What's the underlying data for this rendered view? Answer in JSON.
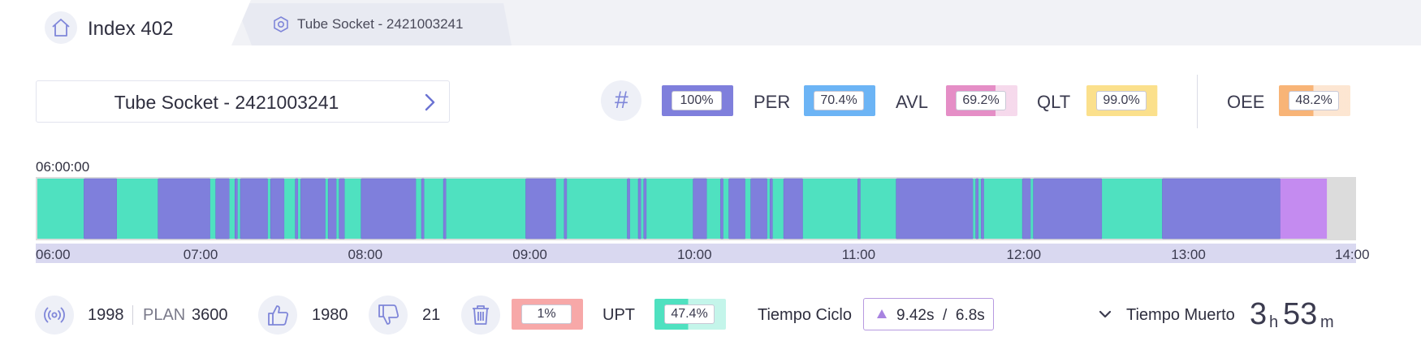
{
  "tabs": {
    "home_icon": "home-icon",
    "active_title": "Index 402",
    "second_icon": "hexagon-icon",
    "second_label": "Tube Socket - 2421003241"
  },
  "selector": {
    "label": "Tube Socket - 2421003241",
    "icon": "chevron-right-icon"
  },
  "metrics": {
    "hash_label": "#",
    "items": [
      {
        "label": "",
        "value": "100%",
        "color": "#7f7fdc",
        "fill": 1.0
      },
      {
        "label": "PER",
        "value": "70.4%",
        "color": "#6cb4f5",
        "fill": 1.0
      },
      {
        "label": "AVL",
        "value": "69.2%",
        "color": "#e58ec6",
        "fill": 0.692
      },
      {
        "label": "QLT",
        "value": "99.0%",
        "color": "#fbe08c",
        "fill": 0.99
      },
      {
        "label": "OEE",
        "value": "48.2%",
        "color": "#f8b477",
        "fill": 0.482
      }
    ]
  },
  "timeline": {
    "start_time": "06:00:00",
    "axis_labels": [
      "06:00",
      "07:00",
      "08:00",
      "09:00",
      "10:00",
      "11:00",
      "12:00",
      "13:00",
      "14:00"
    ],
    "colors": {
      "running": "#4fe1c0",
      "stopped": "#7f7fdc",
      "setup": "#c48bf0",
      "empty": "#dcdcdc",
      "background": "#d9d8f0"
    },
    "segments": [
      [
        "06:00",
        "06:17",
        "running"
      ],
      [
        "06:17",
        "06:29",
        "stopped"
      ],
      [
        "06:29",
        "06:44",
        "running"
      ],
      [
        "06:44",
        "07:03",
        "stopped"
      ],
      [
        "07:03",
        "07:05",
        "running"
      ],
      [
        "07:05",
        "07:10",
        "stopped"
      ],
      [
        "07:10",
        "07:12",
        "running"
      ],
      [
        "07:12",
        "07:13",
        "stopped"
      ],
      [
        "07:13",
        "07:14",
        "running"
      ],
      [
        "07:14",
        "07:24",
        "stopped"
      ],
      [
        "07:24",
        "07:25",
        "running"
      ],
      [
        "07:25",
        "07:30",
        "stopped"
      ],
      [
        "07:30",
        "07:34",
        "running"
      ],
      [
        "07:34",
        "07:35",
        "stopped"
      ],
      [
        "07:35",
        "07:36",
        "running"
      ],
      [
        "07:36",
        "07:45",
        "stopped"
      ],
      [
        "07:45",
        "07:46",
        "running"
      ],
      [
        "07:46",
        "07:49",
        "stopped"
      ],
      [
        "07:49",
        "07:50",
        "running"
      ],
      [
        "07:50",
        "07:52",
        "stopped"
      ],
      [
        "07:52",
        "07:58",
        "running"
      ],
      [
        "07:58",
        "08:18",
        "stopped"
      ],
      [
        "08:18",
        "08:20",
        "running"
      ],
      [
        "08:20",
        "08:21",
        "stopped"
      ],
      [
        "08:21",
        "08:28",
        "running"
      ],
      [
        "08:28",
        "08:29",
        "stopped"
      ],
      [
        "08:29",
        "08:58",
        "running"
      ],
      [
        "08:58",
        "09:09",
        "stopped"
      ],
      [
        "09:09",
        "09:12",
        "running"
      ],
      [
        "09:12",
        "09:13",
        "stopped"
      ],
      [
        "09:13",
        "09:35",
        "running"
      ],
      [
        "09:35",
        "09:36",
        "stopped"
      ],
      [
        "09:36",
        "09:39",
        "running"
      ],
      [
        "09:39",
        "09:40",
        "stopped"
      ],
      [
        "09:40",
        "09:41",
        "running"
      ],
      [
        "09:41",
        "09:42",
        "stopped"
      ],
      [
        "09:42",
        "09:59",
        "running"
      ],
      [
        "09:59",
        "10:04",
        "stopped"
      ],
      [
        "10:04",
        "10:09",
        "running"
      ],
      [
        "10:09",
        "10:10",
        "stopped"
      ],
      [
        "10:10",
        "10:12",
        "running"
      ],
      [
        "10:12",
        "10:18",
        "stopped"
      ],
      [
        "10:18",
        "10:20",
        "running"
      ],
      [
        "10:20",
        "10:26",
        "stopped"
      ],
      [
        "10:26",
        "10:27",
        "running"
      ],
      [
        "10:27",
        "10:28",
        "stopped"
      ],
      [
        "10:28",
        "10:32",
        "running"
      ],
      [
        "10:32",
        "10:39",
        "stopped"
      ],
      [
        "10:39",
        "10:59",
        "running"
      ],
      [
        "10:59",
        "11:00",
        "stopped"
      ],
      [
        "11:00",
        "11:13",
        "running"
      ],
      [
        "11:13",
        "11:41",
        "stopped"
      ],
      [
        "11:41",
        "11:42",
        "running"
      ],
      [
        "11:42",
        "11:43",
        "stopped"
      ],
      [
        "11:43",
        "11:44",
        "running"
      ],
      [
        "11:44",
        "11:45",
        "stopped"
      ],
      [
        "11:45",
        "11:59",
        "running"
      ],
      [
        "11:59",
        "12:02",
        "stopped"
      ],
      [
        "12:02",
        "12:03",
        "running"
      ],
      [
        "12:03",
        "12:28",
        "stopped"
      ],
      [
        "12:28",
        "12:50",
        "running"
      ],
      [
        "12:50",
        "13:33",
        "stopped"
      ],
      [
        "13:33",
        "13:50",
        "setup"
      ],
      [
        "13:50",
        "14:00",
        "empty"
      ]
    ]
  },
  "footer": {
    "signal_icon": "signal-icon",
    "count": "1998",
    "plan_label": "PLAN",
    "plan_value": "3600",
    "good_icon": "thumbs-up-icon",
    "good_count": "1980",
    "bad_icon": "thumbs-down-icon",
    "bad_count": "21",
    "trash_icon": "trash-icon",
    "scrap_value": "1%",
    "scrap_color": "#f7a8a8",
    "upt_label": "UPT",
    "upt_value": "47.4%",
    "upt_color": "#4fe1c0",
    "upt_fill": 0.474,
    "ciclo_label": "Tiempo Ciclo",
    "ciclo_value": "9.42s  /  6.8s",
    "muerto_label": "Tiempo Muerto",
    "muerto_hours": "3",
    "muerto_h_unit": "h",
    "muerto_minutes": "53",
    "muerto_m_unit": "m"
  }
}
